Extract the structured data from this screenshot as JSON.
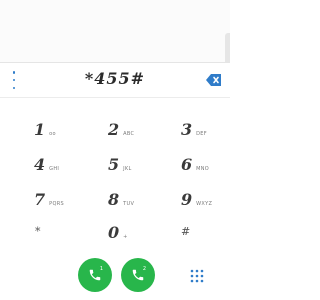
{
  "dialer": {
    "number": "*455#",
    "more_icon": "more-vertical-icon",
    "backspace_icon": "backspace-icon",
    "accent_color": "#2f7cc9"
  },
  "keys": [
    {
      "digit": "1",
      "letters": "oo",
      "icon": "voicemail-icon"
    },
    {
      "digit": "2",
      "letters": "ABC"
    },
    {
      "digit": "3",
      "letters": "DEF"
    },
    {
      "digit": "4",
      "letters": "GHI"
    },
    {
      "digit": "5",
      "letters": "JKL"
    },
    {
      "digit": "6",
      "letters": "MNO"
    },
    {
      "digit": "7",
      "letters": "PQRS"
    },
    {
      "digit": "8",
      "letters": "TUV"
    },
    {
      "digit": "9",
      "letters": "WXYZ"
    },
    {
      "digit": "*",
      "letters": ""
    },
    {
      "digit": "0",
      "letters": "+"
    },
    {
      "digit": "#",
      "letters": ""
    }
  ],
  "calls": {
    "sim1_label": "1",
    "sim2_label": "2",
    "call_color": "#28b64b",
    "keypad_icon": "dialpad-grid-icon"
  }
}
